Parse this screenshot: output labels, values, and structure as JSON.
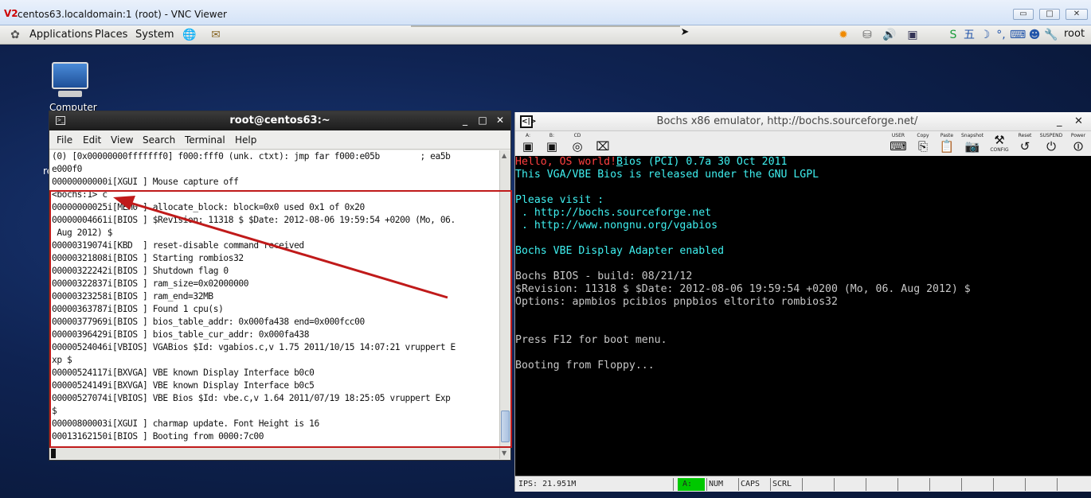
{
  "vnc": {
    "logo": "V2",
    "title": "centos63.localdomain:1 (root) - VNC Viewer",
    "buttons": {
      "minimize": "▭",
      "maximize": "□",
      "close": "✕"
    }
  },
  "panel": {
    "menus": [
      "Applications",
      "Places",
      "System"
    ],
    "user": "root",
    "tray_icons": [
      "weather-sun-icon",
      "network-icon",
      "volume-icon",
      "display-icon",
      "input-method-icon"
    ]
  },
  "desktop": {
    "computer_label": "Computer",
    "stray_text": "re"
  },
  "terminal": {
    "title": "root@centos63:~",
    "menu": [
      "File",
      "Edit",
      "View",
      "Search",
      "Terminal",
      "Help"
    ],
    "lines": [
      "(0) [0x00000000fffffff0] f000:fff0 (unk. ctxt): jmp far f000:e05b        ; ea5b",
      "e000f0",
      "00000000000i[XGUI ] Mouse capture off",
      "<bochs:1> c",
      "00000000025i[MEM0 ] allocate_block: block=0x0 used 0x1 of 0x20",
      "00000004661i[BIOS ] $Revision: 11318 $ $Date: 2012-08-06 19:59:54 +0200 (Mo, 06.",
      " Aug 2012) $",
      "00000319074i[KBD  ] reset-disable command received",
      "00000321808i[BIOS ] Starting rombios32",
      "00000322242i[BIOS ] Shutdown flag 0",
      "00000322837i[BIOS ] ram_size=0x02000000",
      "00000323258i[BIOS ] ram_end=32MB",
      "00000363787i[BIOS ] Found 1 cpu(s)",
      "00000377969i[BIOS ] bios_table_addr: 0x000fa438 end=0x000fcc00",
      "00000396429i[BIOS ] bios_table_cur_addr: 0x000fa438",
      "00000524046i[VBIOS] VGABios $Id: vgabios.c,v 1.75 2011/10/15 14:07:21 vruppert E",
      "xp $",
      "00000524117i[BXVGA] VBE known Display Interface b0c0",
      "00000524149i[BXVGA] VBE known Display Interface b0c5",
      "00000527074i[VBIOS] VBE Bios $Id: vbe.c,v 1.64 2011/07/19 18:25:05 vruppert Exp",
      "$",
      "00000800003i[XGUI ] charmap update. Font Height is 16",
      "00013162150i[BIOS ] Booting from 0000:7c00"
    ]
  },
  "bochs": {
    "icon": "<|>",
    "title": "Bochs x86 emulator, http://bochs.sourceforge.net/",
    "toolbar_left": [
      "A:",
      "B:",
      "CD",
      ""
    ],
    "toolbar_right": [
      "USER",
      "Copy",
      "Paste",
      "Snapshot",
      "CONFIG",
      "Reset",
      "SUSPEND",
      "Power"
    ],
    "screen": {
      "hello": "Hello, OS world!",
      "line1_rest": "ios (PCI) 0.7a 30 Oct 2011",
      "line1_cursor": "B",
      "lines_cyan": [
        "This VGA/VBE Bios is released under the GNU LGPL",
        "",
        "Please visit :",
        " . http://bochs.sourceforge.net",
        " . http://www.nongnu.org/vgabios",
        "",
        "Bochs VBE Display Adapter enabled"
      ],
      "lines_gray": [
        "Bochs BIOS - build: 08/21/12",
        "$Revision: 11318 $ $Date: 2012-08-06 19:59:54 +0200 (Mo, 06. Aug 2012) $",
        "Options: apmbios pcibios pnpbios eltorito rombios32",
        "",
        "",
        "Press F12 for boot menu.",
        "",
        "Booting from Floppy..."
      ]
    },
    "status": {
      "ips": "IPS: 21.951M",
      "a": "A:",
      "num": "NUM",
      "caps": "CAPS",
      "scrl": "SCRL"
    }
  },
  "colors": {
    "annotation": "#c01a1a",
    "bochs_cyan": "#3ff0f0",
    "bochs_red": "#ff4040",
    "bochs_gray": "#c8c8c8",
    "status_green": "#00c800"
  }
}
